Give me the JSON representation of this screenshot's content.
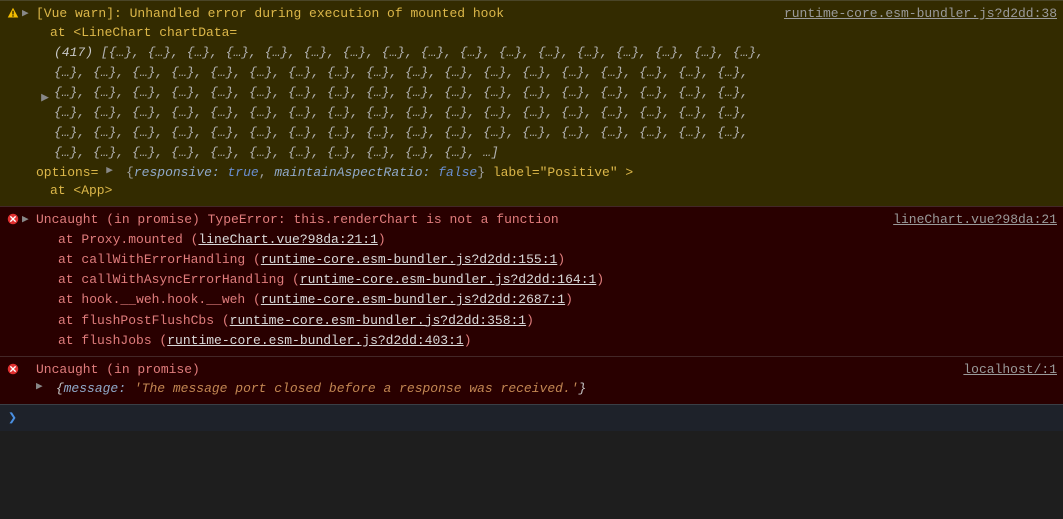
{
  "entries": [
    {
      "kind": "warn",
      "source": "runtime-core.esm-bundler.js?d2dd:38",
      "warnPrefix": "[Vue warn]: Unhandled error during execution of mounted hook",
      "componentLine": "at <LineChart chartData=",
      "arrayCount": "(417)",
      "arrayPreview": "[{…}, {…}, {…}, {…}, {…}, {…}, {…}, {…}, {…}, {…}, {…}, {…}, {…}, {…}, {…}, {…}, {…}, {…}, {…}, {…}, {…}, {…}, {…}, {…}, {…}, {…}, {…}, {…}, {…}, {…}, {…}, {…}, {…}, {…}, {…}, {…}, {…}, {…}, {…}, {…}, {…}, {…}, {…}, {…}, {…}, {…}, {…}, {…}, {…}, {…}, {…}, {…}, {…}, {…}, {…}, {…}, {…}, {…}, {…}, {…}, {…}, {…}, {…}, {…}, {…}, {…}, {…}, {…}, {…}, {…}, {…}, {…}, {…}, {…}, {…}, {…}, {…}, {…}, {…}, {…}, {…}, {…}, {…}, {…}, {…}, {…}, {…}, {…}, {…}, {…}, {…}, {…}, {…}, {…}, {…}, {…}, {…}, {…}, {…}, {…}, …]",
      "optionsLabel": "options=",
      "optionsObj": {
        "responsiveKey": "responsive:",
        "responsiveVal": "true",
        "marKey": "maintainAspectRatio:",
        "marVal": "false"
      },
      "labelProp": "label=\"Positive\" >",
      "atApp": "at <App>"
    },
    {
      "kind": "error",
      "source": "lineChart.vue?98da:21",
      "message": "Uncaught (in promise) TypeError: this.renderChart is not a function",
      "stack": [
        {
          "at": "at",
          "fn": "Proxy.mounted",
          "loc": "lineChart.vue?98da:21:1"
        },
        {
          "at": "at",
          "fn": "callWithErrorHandling",
          "loc": "runtime-core.esm-bundler.js?d2dd:155:1"
        },
        {
          "at": "at",
          "fn": "callWithAsyncErrorHandling",
          "loc": "runtime-core.esm-bundler.js?d2dd:164:1"
        },
        {
          "at": "at",
          "fn": "hook.__weh.hook.__weh",
          "loc": "runtime-core.esm-bundler.js?d2dd:2687:1"
        },
        {
          "at": "at",
          "fn": "flushPostFlushCbs",
          "loc": "runtime-core.esm-bundler.js?d2dd:358:1"
        },
        {
          "at": "at",
          "fn": "flushJobs",
          "loc": "runtime-core.esm-bundler.js?d2dd:403:1"
        }
      ]
    },
    {
      "kind": "error2",
      "source": "localhost/:1",
      "message": "Uncaught (in promise)",
      "objKey": "message:",
      "objVal": "'The message port closed before a response was received.'"
    }
  ],
  "glyphs": {
    "arrow": "▶",
    "prompt": "❯"
  }
}
